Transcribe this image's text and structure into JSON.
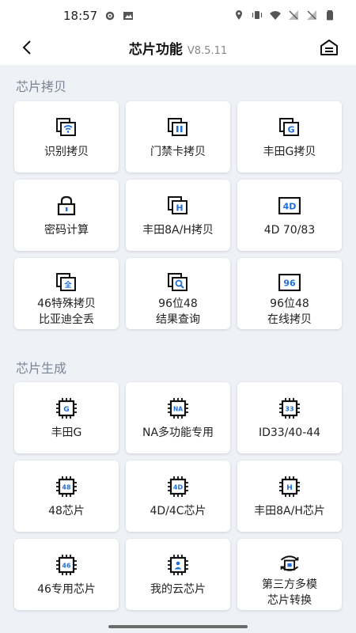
{
  "status": {
    "time": "18:57"
  },
  "header": {
    "title": "芯片功能",
    "version": "V8.5.11"
  },
  "sections": [
    {
      "title": "芯片拷贝",
      "items": [
        {
          "label": "识别拷贝",
          "icon": "chip-copy-wifi-icon"
        },
        {
          "label": "门禁卡拷贝",
          "icon": "access-card-copy-icon"
        },
        {
          "label": "丰田G拷贝",
          "icon": "toyota-g-copy-icon"
        },
        {
          "label": "密码计算",
          "icon": "lock-icon"
        },
        {
          "label": "丰田8A/H拷贝",
          "icon": "toyota-h-copy-icon"
        },
        {
          "label": "4D 70/83",
          "icon": "4d-icon"
        },
        {
          "label": "46特殊拷贝\n比亚迪全丢",
          "icon": "46-special-copy-icon"
        },
        {
          "label": "96位48\n结果查询",
          "icon": "search-copy-icon"
        },
        {
          "label": "96位48\n在线拷贝",
          "icon": "96-icon"
        }
      ]
    },
    {
      "title": "芯片生成",
      "items": [
        {
          "label": "丰田G",
          "icon": "chip-g-icon"
        },
        {
          "label": "NA多功能专用",
          "icon": "chip-na-icon"
        },
        {
          "label": "ID33/40-44",
          "icon": "chip-33-icon"
        },
        {
          "label": "48芯片",
          "icon": "chip-48-icon"
        },
        {
          "label": "4D/4C芯片",
          "icon": "chip-4d-icon"
        },
        {
          "label": "丰田8A/H芯片",
          "icon": "chip-h-icon"
        },
        {
          "label": "46专用芯片",
          "icon": "chip-46-icon"
        },
        {
          "label": "我的云芯片",
          "icon": "chip-cloud-icon"
        },
        {
          "label": "第三方多模\n芯片转换",
          "icon": "chip-convert-icon"
        }
      ]
    }
  ],
  "colors": {
    "accent": "#1e6fd9",
    "ink": "#111111",
    "background": "#eef1f6"
  }
}
